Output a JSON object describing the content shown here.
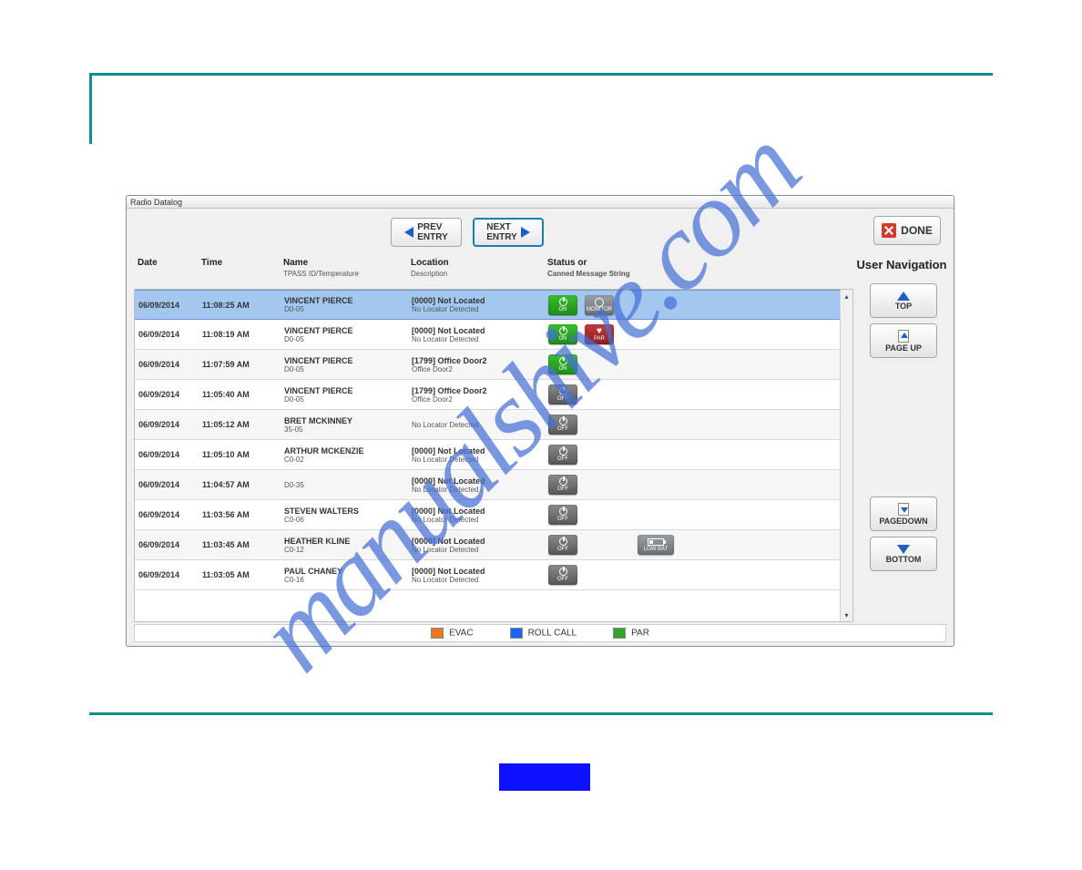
{
  "window": {
    "title": "Radio Datalog"
  },
  "toolbar": {
    "prev_line1": "PREV",
    "prev_line2": "ENTRY",
    "next_line1": "NEXT",
    "next_line2": "ENTRY",
    "done_label": "DONE"
  },
  "headers": {
    "date": "Date",
    "time": "Time",
    "name": "Name",
    "name_sub": "TPASS ID/Temperature",
    "location": "Location",
    "location_sub": "Description",
    "status": "Status or",
    "status_sub": "Canned Message String"
  },
  "side": {
    "title": "User Navigation",
    "top": "TOP",
    "pageup": "PAGE UP",
    "pagedown": "PAGEDOWN",
    "bottom": "BOTTOM"
  },
  "legend": {
    "evac": "EVAC",
    "rollcall": "ROLL CALL",
    "par": "PAR"
  },
  "rows": [
    {
      "date": "06/09/2014",
      "time": "11:08:25 AM",
      "name": "VINCENT PIERCE",
      "id": "D0-05",
      "loc1": "[0000] Not Located",
      "loc2": "No Locator Detected",
      "power": "on",
      "extra": "monitor",
      "selected": true
    },
    {
      "date": "06/09/2014",
      "time": "11:08:19 AM",
      "name": "VINCENT PIERCE",
      "id": "D0-05",
      "loc1": "[0000] Not Located",
      "loc2": "No Locator Detected",
      "power": "on",
      "extra": "par"
    },
    {
      "date": "06/09/2014",
      "time": "11:07:59 AM",
      "name": "VINCENT PIERCE",
      "id": "D0-05",
      "loc1": "[1799] Office Door2",
      "loc2": "Office Door2",
      "power": "on"
    },
    {
      "date": "06/09/2014",
      "time": "11:05:40 AM",
      "name": "VINCENT PIERCE",
      "id": "D0-05",
      "loc1": "[1799] Office Door2",
      "loc2": "Office Door2",
      "power": "off"
    },
    {
      "date": "06/09/2014",
      "time": "11:05:12 AM",
      "name": "BRET MCKINNEY",
      "id": "35-05",
      "loc1": "",
      "loc2": "No Locator Detected",
      "power": "off"
    },
    {
      "date": "06/09/2014",
      "time": "11:05:10 AM",
      "name": "ARTHUR MCKENZIE",
      "id": "C0-02",
      "loc1": "[0000] Not Located",
      "loc2": "No Locator Detected",
      "power": "off"
    },
    {
      "date": "06/09/2014",
      "time": "11:04:57 AM",
      "name": "",
      "id": "D0-35",
      "loc1": "[0000] Not Located",
      "loc2": "No Locator Detected",
      "power": "off"
    },
    {
      "date": "06/09/2014",
      "time": "11:03:56 AM",
      "name": "STEVEN WALTERS",
      "id": "C0-06",
      "loc1": "[0000] Not Located",
      "loc2": "No Locator Detected",
      "power": "off"
    },
    {
      "date": "06/09/2014",
      "time": "11:03:45 AM",
      "name": "HEATHER KLINE",
      "id": "C0-12",
      "loc1": "[0000] Not Located",
      "loc2": "No Locator Detected",
      "power": "off",
      "extra": "lowbat",
      "extra_label": "LOW BAT"
    },
    {
      "date": "06/09/2014",
      "time": "11:03:05 AM",
      "name": "PAUL CHANEY",
      "id": "C0-16",
      "loc1": "[0000] Not Located",
      "loc2": "No Locator Detected",
      "power": "off"
    }
  ],
  "badge_labels": {
    "on": "ON",
    "off": "OFF",
    "par": "PAR",
    "monitor": "MONITOR"
  }
}
